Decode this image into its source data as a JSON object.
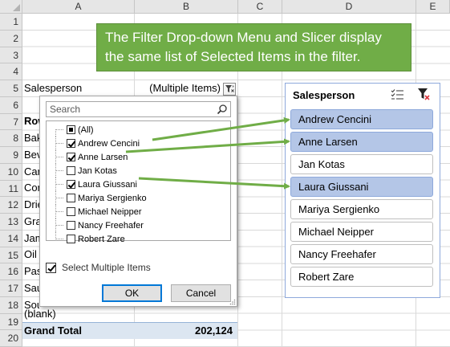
{
  "columns": [
    "A",
    "B",
    "C",
    "D",
    "E"
  ],
  "rows": [
    "1",
    "2",
    "3",
    "4",
    "5",
    "6",
    "7",
    "8",
    "9",
    "10",
    "11",
    "12",
    "13",
    "14",
    "15",
    "16",
    "17",
    "18",
    "19",
    "20"
  ],
  "callout": {
    "line1": "The Filter Drop-down Menu and Slicer display",
    "line2": "the same list of Selected Items in the filter.",
    "color": "#70ad47"
  },
  "pivot": {
    "filter_field": "Salesperson",
    "filter_value": "(Multiple Items)",
    "filter_icon": "filter-funnel-icon",
    "row_labels_partial": [
      "Row",
      "Bak",
      "Bev",
      "Car",
      "Con",
      "Drie",
      "Gra",
      "Jam",
      "Oil",
      "Pas",
      "Sau",
      "Sou"
    ],
    "blank_label": "(blank)",
    "grand_total_label": "Grand Total",
    "grand_total_value": "202,124",
    "total_row_color": "#dce6f1"
  },
  "filter_dropdown": {
    "search_placeholder": "Search",
    "items": [
      {
        "label": "(All)",
        "state": "mixed"
      },
      {
        "label": "Andrew Cencini",
        "state": "checked"
      },
      {
        "label": "Anne Larsen",
        "state": "checked"
      },
      {
        "label": "Jan Kotas",
        "state": "unchecked"
      },
      {
        "label": "Laura Giussani",
        "state": "checked"
      },
      {
        "label": "Mariya Sergienko",
        "state": "unchecked"
      },
      {
        "label": "Michael Neipper",
        "state": "unchecked"
      },
      {
        "label": "Nancy Freehafer",
        "state": "unchecked"
      },
      {
        "label": "Robert Zare",
        "state": "unchecked"
      }
    ],
    "select_multiple_label": "Select Multiple Items",
    "select_multiple_checked": true,
    "ok_label": "OK",
    "cancel_label": "Cancel"
  },
  "slicer": {
    "title": "Salesperson",
    "selected_color": "#b4c6e7",
    "items": [
      {
        "label": "Andrew Cencini",
        "selected": true
      },
      {
        "label": "Anne Larsen",
        "selected": true
      },
      {
        "label": "Jan Kotas",
        "selected": false
      },
      {
        "label": "Laura Giussani",
        "selected": true
      },
      {
        "label": "Mariya Sergienko",
        "selected": false
      },
      {
        "label": "Michael Neipper",
        "selected": false
      },
      {
        "label": "Nancy Freehafer",
        "selected": false
      },
      {
        "label": "Robert Zare",
        "selected": false
      }
    ]
  },
  "arrow_color": "#70ad47"
}
